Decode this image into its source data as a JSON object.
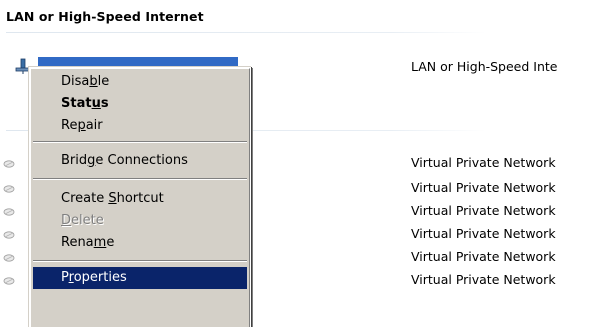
{
  "group": {
    "title": "LAN or High-Speed Internet"
  },
  "lan_item": {
    "type": "LAN or High-Speed Inte"
  },
  "vpn_items": [
    {
      "type": "Virtual Private Network"
    },
    {
      "type": "Virtual Private Network"
    },
    {
      "type": "Virtual Private Network"
    },
    {
      "type": "Virtual Private Network"
    },
    {
      "type": "Virtual Private Network"
    },
    {
      "type": "Virtual Private Network"
    }
  ],
  "menu": {
    "items": [
      {
        "label": "Disable",
        "accel": "b",
        "state": "normal"
      },
      {
        "label": "Status",
        "accel": "u",
        "state": "default"
      },
      {
        "label": "Repair",
        "accel": "p",
        "state": "normal"
      },
      {
        "label": "Bridge Connections",
        "accel": "g",
        "state": "normal"
      },
      {
        "label": "Create Shortcut",
        "accel": "S",
        "state": "normal"
      },
      {
        "label": "Delete",
        "accel": "D",
        "state": "disabled"
      },
      {
        "label": "Rename",
        "accel": "m",
        "state": "normal"
      },
      {
        "label": "Properties",
        "accel": "r",
        "state": "highlighted"
      }
    ]
  },
  "colors": {
    "menu_bg": "#d4d0c8",
    "highlight_bg": "#0a246a",
    "selection_bg": "#316ac5"
  }
}
